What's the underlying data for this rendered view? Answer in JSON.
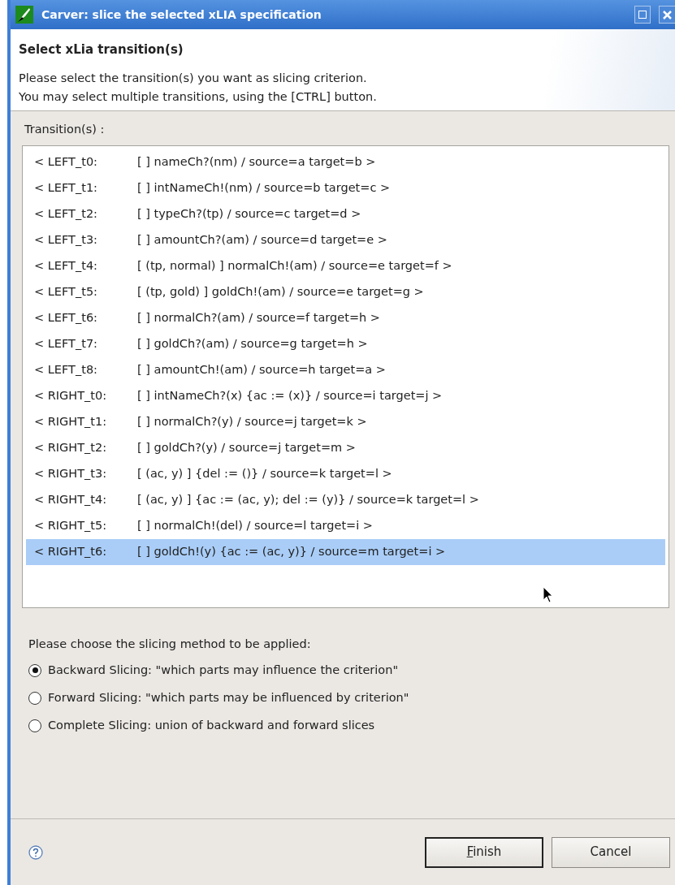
{
  "window": {
    "title": "Carver: slice the selected xLIA specification"
  },
  "header": {
    "title": "Select xLia transition(s)",
    "description": [
      "Please select the transition(s) you want as slicing criterion.",
      "You may select multiple transitions, using the [CTRL] button."
    ]
  },
  "transitions_label": "Transition(s) :",
  "transitions": [
    {
      "name": "< LEFT_t0:",
      "detail": "[  ] nameCh?(nm)  / source=a target=b >",
      "selected": false
    },
    {
      "name": "< LEFT_t1:",
      "detail": "[  ] intNameCh!(nm)  / source=b target=c >",
      "selected": false
    },
    {
      "name": "< LEFT_t2:",
      "detail": "[  ] typeCh?(tp)  / source=c target=d >",
      "selected": false
    },
    {
      "name": "< LEFT_t3:",
      "detail": "[  ] amountCh?(am)  / source=d target=e >",
      "selected": false
    },
    {
      "name": "< LEFT_t4:",
      "detail": "[ (tp, normal) ] normalCh!(am)  / source=e target=f >",
      "selected": false
    },
    {
      "name": "< LEFT_t5:",
      "detail": "[ (tp, gold) ] goldCh!(am)  / source=e target=g >",
      "selected": false
    },
    {
      "name": "< LEFT_t6:",
      "detail": "[  ] normalCh?(am)  / source=f target=h >",
      "selected": false
    },
    {
      "name": "< LEFT_t7:",
      "detail": "[  ] goldCh?(am)  / source=g target=h >",
      "selected": false
    },
    {
      "name": "< LEFT_t8:",
      "detail": "[  ] amountCh!(am)  / source=h target=a >",
      "selected": false
    },
    {
      "name": "< RIGHT_t0:",
      "detail": "[  ] intNameCh?(x) {ac := (x)} / source=i target=j >",
      "selected": false
    },
    {
      "name": "< RIGHT_t1:",
      "detail": "[  ] normalCh?(y)  / source=j target=k >",
      "selected": false
    },
    {
      "name": "< RIGHT_t2:",
      "detail": "[  ] goldCh?(y)  / source=j target=m >",
      "selected": false
    },
    {
      "name": "< RIGHT_t3:",
      "detail": "[ (ac, y) ]  {del := ()} / source=k target=l >",
      "selected": false
    },
    {
      "name": "< RIGHT_t4:",
      "detail": "[ (ac, y) ]  {ac := (ac, y); del := (y)} / source=k target=l >",
      "selected": false
    },
    {
      "name": "< RIGHT_t5:",
      "detail": "[  ] normalCh!(del)  / source=l target=i >",
      "selected": false
    },
    {
      "name": "< RIGHT_t6:",
      "detail": "[  ] goldCh!(y) {ac := (ac, y)} / source=m target=i >",
      "selected": true
    }
  ],
  "method_label": "Please choose the slicing method to be applied:",
  "methods": [
    {
      "label": "Backward Slicing: \"which parts may influence the criterion\"",
      "selected": true
    },
    {
      "label": "Forward Slicing: \"which parts may be influenced by criterion\"",
      "selected": false
    },
    {
      "label": "Complete Slicing: union of backward and forward slices",
      "selected": false
    }
  ],
  "buttons": [
    {
      "label": "Finish",
      "kind": "default"
    },
    {
      "label": "Cancel",
      "kind": "normal"
    }
  ]
}
